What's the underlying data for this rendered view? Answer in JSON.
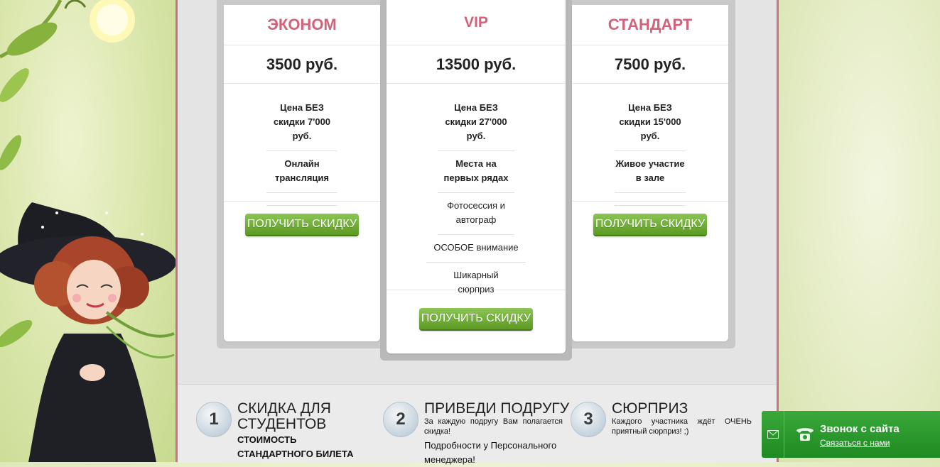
{
  "colors": {
    "accent_pink": "#d4607a",
    "cta_green": "#6aa92e",
    "border_pink": "#cd6f86",
    "widget_green": "#2a9a2e"
  },
  "plans": [
    {
      "name": "ЭКОНОМ",
      "price": "3500 руб.",
      "features": [
        "Цена БЕЗ скидки 7'000 руб.",
        "Онлайн трансляция"
      ],
      "cta": "ПОЛУЧИТЬ СКИДКУ"
    },
    {
      "name": "VIP",
      "price": "13500 руб.",
      "features": [
        "Цена БЕЗ скидки 27'000 руб.",
        "Места на первых рядах",
        "Фотосессия и автограф",
        "ОСОБОЕ внимание",
        "Шикарный сюрприз"
      ],
      "cta": "ПОЛУЧИТЬ СКИДКУ"
    },
    {
      "name": "СТАНДАРТ",
      "price": "7500 руб.",
      "features": [
        "Цена БЕЗ скидки 15'000 руб.",
        "Живое участие в зале"
      ],
      "cta": "ПОЛУЧИТЬ СКИДКУ"
    }
  ],
  "offers": [
    {
      "number": "1",
      "title": "СКИДКА ДЛЯ СТУДЕНТОВ",
      "text": "СТОИМОСТЬ СТАНДАРТНОГО БИЛЕТА"
    },
    {
      "number": "2",
      "title": "ПРИВЕДИ ПОДРУГУ",
      "text": "За каждую подругу Вам полагается скидка!",
      "text2": "Подробности у Персонального менеджера!"
    },
    {
      "number": "3",
      "title": "СЮРПРИЗ",
      "text": "Каждого участника ждёт ОЧЕНЬ приятный сюрприз! ;)"
    }
  ],
  "callback_widget": {
    "title": "Звонок с сайта",
    "link": "Связаться с нами",
    "icons": [
      "mail-icon",
      "phone-icon"
    ]
  }
}
